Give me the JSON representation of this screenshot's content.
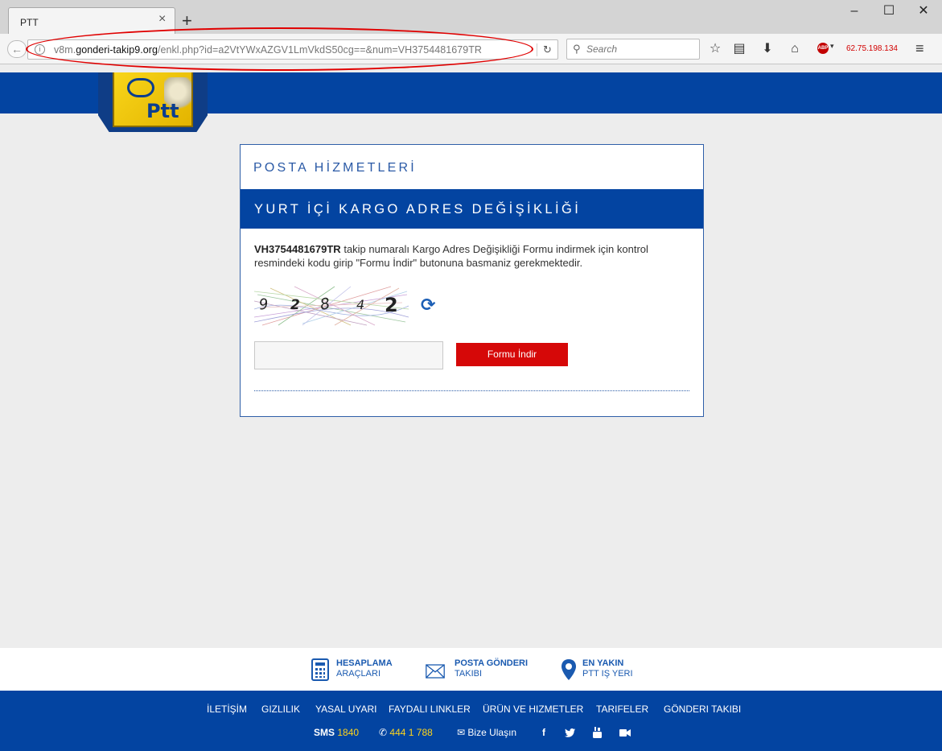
{
  "browser": {
    "tab_title": "PTT",
    "url_prefix": "v8m.",
    "url_domain": "gonderi-takip9.org",
    "url_path": "/enkl.php?id=a2VtYWxAZGV1LmVkdS50cg==&num=VH3754481679TR",
    "search_placeholder": "Search",
    "ip_label": "62.75.198.134",
    "abp_label": "ABP",
    "annotation_color": "#e00000"
  },
  "panel": {
    "section_title": "POSTA HİZMETLERİ",
    "form_title": "YURT İÇİ KARGO ADRES DEĞİŞİKLİĞİ",
    "tracking_number": "VH3754481679TR",
    "description": "takip numaralı Kargo Adres Değişikliği Formu indirmek için kontrol resmindeki kodu girip \"Formu İndir\" butonuna basmaniz gerekmektedir.",
    "captcha_digits": [
      "9",
      "2",
      "8",
      "4",
      "2"
    ],
    "code_value": "",
    "submit_label": "Formu İndir"
  },
  "quick_links": [
    {
      "line1": "HESAPLAMA",
      "line2": "ARAÇLARI",
      "icon": "calculator-icon"
    },
    {
      "line1": "POSTA GÖNDERI",
      "line2": "TAKIBI",
      "icon": "envelope-icon"
    },
    {
      "line1": "EN YAKIN",
      "line2": "PTT IŞ YERI",
      "icon": "location-pin-icon"
    }
  ],
  "footer": {
    "links": [
      "İLETİŞİM",
      "GIZLILIK",
      "YASAL UYARI",
      "FAYDALI LINKLER",
      "ÜRÜN VE HIZMETLER",
      "TARIFELER",
      "GÖNDERI TAKIBI"
    ],
    "sms_label": "SMS",
    "sms_number": "1840",
    "phone": "444 1 788",
    "contact_label": "Bize Ulaşın"
  },
  "colors": {
    "brand_blue": "#0344a1",
    "ptt_yellow": "#f8d51a",
    "button_red": "#d60808"
  }
}
